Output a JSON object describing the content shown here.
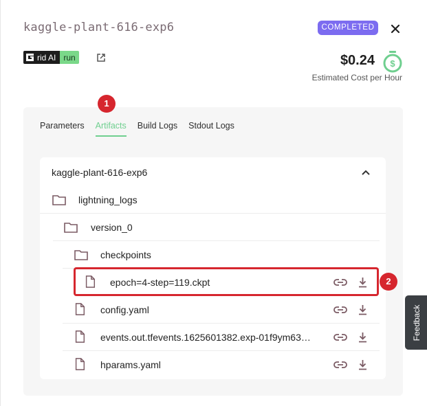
{
  "header": {
    "experiment_name": "kaggle-plant-616-exp6",
    "status": "COMPLETED",
    "close_icon": "close-icon"
  },
  "run_tag": {
    "brand": "rid AI",
    "run_label": "run",
    "link_icon": "external-link-icon"
  },
  "cost": {
    "value": "$0.24",
    "label": "Estimated Cost per Hour",
    "icon": "stopwatch-dollar-icon"
  },
  "tabs": [
    {
      "label": "Parameters",
      "active": false
    },
    {
      "label": "Artifacts",
      "active": true
    },
    {
      "label": "Build Logs",
      "active": false
    },
    {
      "label": "Stdout Logs",
      "active": false
    }
  ],
  "artifacts": {
    "root": "kaggle-plant-616-exp6",
    "items": [
      {
        "name": "lightning_logs",
        "kind": "folder",
        "depth": 0
      },
      {
        "name": "version_0",
        "kind": "folder",
        "depth": 1
      },
      {
        "name": "checkpoints",
        "kind": "folder",
        "depth": 2
      },
      {
        "name": "epoch=4-step=119.ckpt",
        "kind": "file",
        "depth": 3
      },
      {
        "name": "config.yaml",
        "kind": "file",
        "depth": 2
      },
      {
        "name": "events.out.tfevents.1625601382.exp-01f9ym63…",
        "kind": "file",
        "depth": 2
      },
      {
        "name": "hparams.yaml",
        "kind": "file",
        "depth": 2
      }
    ]
  },
  "annotations": {
    "marker_1": "1",
    "marker_2": "2"
  },
  "feedback": {
    "label": "Feedback"
  },
  "colors": {
    "accent_green": "#6fcf8f",
    "status_purple": "#7c6cf0",
    "highlight_red": "#d6262e",
    "icon_brown": "#7a5a63"
  }
}
